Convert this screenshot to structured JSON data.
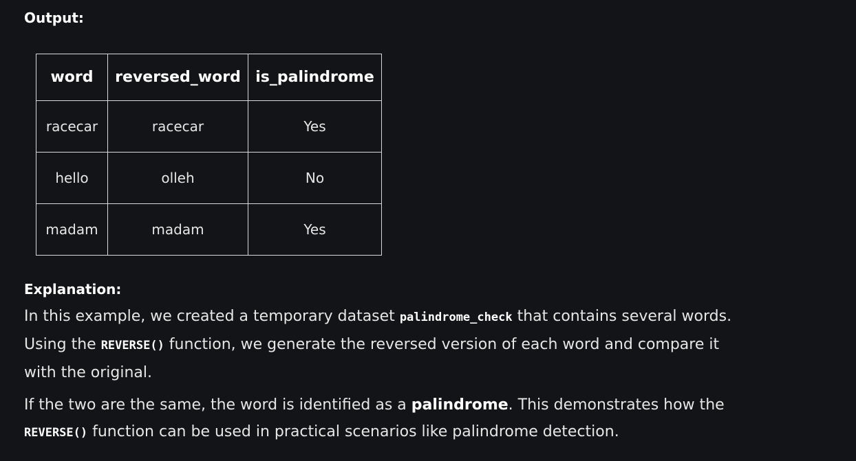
{
  "output_label": "Output:",
  "table": {
    "headers": [
      "word",
      "reversed_word",
      "is_palindrome"
    ],
    "rows": [
      [
        "racecar",
        "racecar",
        "Yes"
      ],
      [
        "hello",
        "olleh",
        "No"
      ],
      [
        "madam",
        "madam",
        "Yes"
      ]
    ]
  },
  "explanation_label": "Explanation:",
  "paragraph1": {
    "t1": "In this example, we created a temporary dataset ",
    "code1": "palindrome_check",
    "t2": " that contains several words. Using the ",
    "code2": "REVERSE()",
    "t3": " function, we generate the reversed version of each word and compare it with the original."
  },
  "paragraph2": {
    "t1": "If the two are the same, the word is identified as a ",
    "bold1": "palindrome",
    "t2": ". This demonstrates how the ",
    "code1": "REVERSE()",
    "t3": " function can be used in practical scenarios like palindrome detection."
  },
  "colors": {
    "background": "#131417",
    "text": "#e6e6e6",
    "border": "#d9d9d9"
  }
}
